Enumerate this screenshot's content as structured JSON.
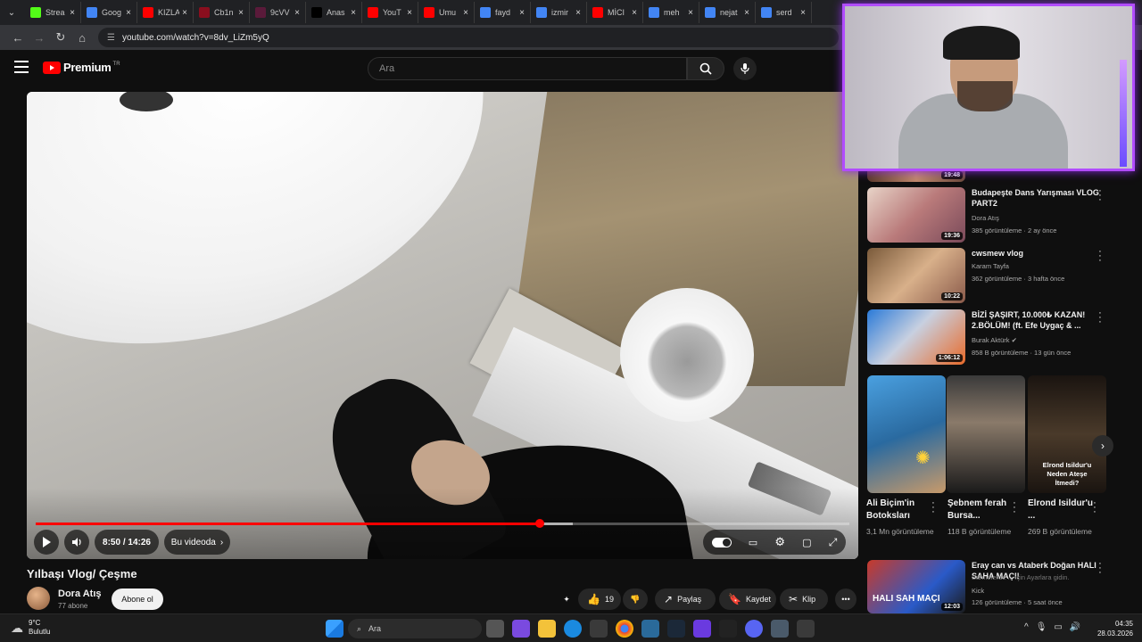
{
  "browser": {
    "tabs": [
      {
        "label": "Strea",
        "icon": "kick-icon",
        "color": "#53fc18"
      },
      {
        "label": "Goog",
        "icon": "google-icon",
        "color": "#4285f4"
      },
      {
        "label": "KIZLA",
        "icon": "youtube-icon",
        "color": "#ff0000"
      },
      {
        "label": "Cb1n",
        "icon": "site-icon",
        "color": "#8a0e1e"
      },
      {
        "label": "9cVV",
        "icon": "site-icon",
        "color": "#5a1a3a"
      },
      {
        "label": "Anas",
        "icon": "x-icon",
        "color": "#000000"
      },
      {
        "label": "YouT",
        "icon": "youtube-icon",
        "color": "#ff0000"
      },
      {
        "label": "Umu",
        "icon": "youtube-icon",
        "color": "#ff0000"
      },
      {
        "label": "fayd",
        "icon": "google-icon",
        "color": "#4285f4"
      },
      {
        "label": "izmir",
        "icon": "google-icon",
        "color": "#4285f4"
      },
      {
        "label": "MİCI",
        "icon": "youtube-icon",
        "color": "#ff0000"
      },
      {
        "label": "meh",
        "icon": "google-icon",
        "color": "#4285f4"
      },
      {
        "label": "nejat",
        "icon": "google-icon",
        "color": "#4285f4"
      },
      {
        "label": "serd",
        "icon": "google-icon",
        "color": "#4285f4"
      }
    ],
    "url": "youtube.com/watch?v=8dv_LiZm5yQ"
  },
  "header": {
    "logo_text": "Premium",
    "country_code": "TR",
    "search_placeholder": "Ara"
  },
  "player": {
    "time": "8:50 / 14:26",
    "chapter_label": "Bu videoda",
    "progress_fraction": 0.62,
    "buffered_fraction": 0.66
  },
  "video": {
    "title": "Yılbaşı Vlog/ Çeşme",
    "channel": "Dora Atış",
    "subscribers": "77 abone",
    "subscribe_label": "Abone ol",
    "likes": "19",
    "share_label": "Paylaş",
    "save_label": "Kaydet",
    "clip_label": "Klip"
  },
  "recommendations": [
    {
      "title": "",
      "channel": "",
      "meta": "",
      "duration": "19:48"
    },
    {
      "title": "Budapeşte Dans Yarışması VLOG PART2",
      "channel": "Dora Atış",
      "meta": "385 görüntüleme · 2 ay önce",
      "duration": "19:36"
    },
    {
      "title": "cwsmew vlog",
      "channel": "Karam Tayfa",
      "meta": "362 görüntüleme · 3 hafta önce",
      "duration": "10:22"
    },
    {
      "title": "BİZİ ŞAŞIRT, 10.000₺ KAZAN! 2.BÖLÜM! (ft. Efe Uygaç & ...",
      "channel": "Burak Aktürk",
      "meta": "858 B görüntüleme · 13 gün önce",
      "duration": "1:06:12"
    }
  ],
  "shorts": [
    {
      "title": "Ali Biçim'in Botoksları",
      "views": "3,1 Mn görüntüleme"
    },
    {
      "title": "Şebnem ferah Bursa...",
      "views": "118 B görüntüleme"
    },
    {
      "title": "Elrond Isildur'u ...",
      "views": "269 B görüntüleme",
      "overlay": "Elrond Isildur'u Neden Ateşe İtmedi?"
    }
  ],
  "recommendation_last": {
    "title": "Eray can vs Ataberk Doğan HALI SAHA MAÇI!",
    "overlay": "Sahnelerde ... için Ayarlara gidin.",
    "channel": "Kick",
    "meta": "126 görüntüleme · 5 saat önce",
    "duration": "12:03",
    "thumb_text": "HALI SAH MAÇI"
  },
  "taskbar": {
    "weather_temp": "9°C",
    "weather_desc": "Bulutlu",
    "search_label": "Ara",
    "time": "04:35",
    "date": "28.03.2026"
  }
}
